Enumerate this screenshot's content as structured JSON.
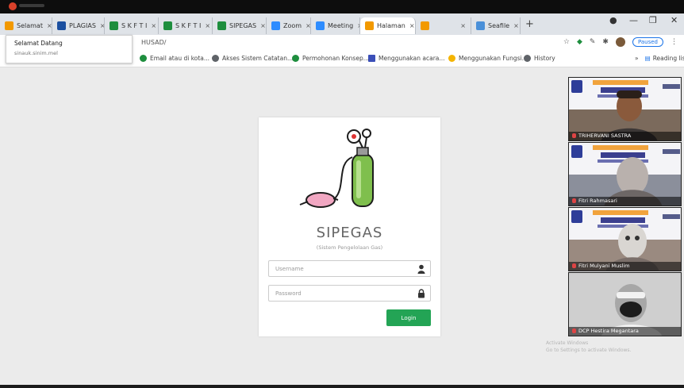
{
  "browser": {
    "tabs": [
      {
        "label": "Selamat",
        "color": "#f29900",
        "active": false
      },
      {
        "label": "PLAGIAS",
        "color": "#1a4fa0",
        "active": false
      },
      {
        "label": "S K F T I",
        "color": "#1e8e3e",
        "active": false
      },
      {
        "label": "S K F T I",
        "color": "#1e8e3e",
        "active": false
      },
      {
        "label": "SIPEGAS",
        "color": "#1e8e3e",
        "active": false
      },
      {
        "label": "Zoom",
        "color": "#2d8cff",
        "active": false
      },
      {
        "label": "Meeting",
        "color": "#2d8cff",
        "active": false
      },
      {
        "label": "Halaman",
        "color": "#f29900",
        "active": true
      },
      {
        "label": "",
        "color": "#f29900",
        "active": false
      },
      {
        "label": "Seafile",
        "color": "#4a90d9",
        "active": false
      }
    ],
    "new_tab_symbol": "+",
    "url": "HUSAD/",
    "profile_status": "Paused",
    "bookmarks": [
      {
        "label": "Email atau di kota...",
        "color": "#1e8e3e"
      },
      {
        "label": "Akses Sistem Catatan...",
        "color": "#5f6368"
      },
      {
        "label": "Permohonan Konsep...",
        "color": "#1e8e3e"
      },
      {
        "label": "Menggunakan acara...",
        "color": "#3b4fb8"
      },
      {
        "label": "Menggunakan Fungsi...",
        "color": "#f4b400"
      },
      {
        "label": "History",
        "color": "#5f6368"
      }
    ],
    "reading_list": "Reading list"
  },
  "welcome_popup": {
    "title": "Selamat Datang",
    "subtitle": "sinauk.sinim.mel"
  },
  "login": {
    "app_title": "SIPEGAS",
    "app_subtitle": "(Sistem Pengelolaan Gas)",
    "username_placeholder": "Username",
    "password_placeholder": "Password",
    "login_label": "Login",
    "button_color": "#23a455"
  },
  "participants": [
    {
      "name": "TRIHERVANI SASTRA"
    },
    {
      "name": "Fitri Rahmasari"
    },
    {
      "name": "Fitri Mulyani Muslim"
    },
    {
      "name": "DCP Hestira Megantara"
    }
  ],
  "watermark": {
    "line1": "Activate Windows",
    "line2": "Go to Settings to activate Windows."
  }
}
